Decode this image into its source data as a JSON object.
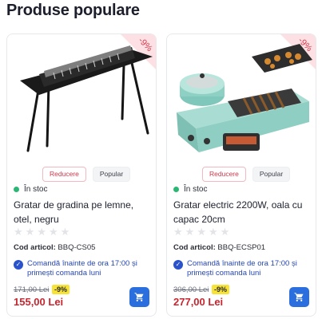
{
  "section": {
    "title": "Produse populare"
  },
  "products": [
    {
      "discount_ribbon": "-9%",
      "badges": [
        "Reducere",
        "Popular"
      ],
      "stock": "În stoc",
      "name": "Gratar de gradina pe lemne, otel, negru",
      "rating": 0,
      "code_label": "Cod articol:",
      "code": "BBQ-CS05",
      "shipping": "Comandă înainte de ora 17:00 și primești comanda luni",
      "old_price": "171,00 Lei",
      "discount": "-9%",
      "price": "155,00 Lei",
      "image_icon": "charcoal-grill-image",
      "cart_icon": "cart-icon"
    },
    {
      "discount_ribbon": "-9%",
      "badges": [
        "Reducere",
        "Popular"
      ],
      "stock": "În stoc",
      "name": "Gratar electric 2200W, oala cu capac 20cm",
      "rating": 0,
      "code_label": "Cod articol:",
      "code": "BBQ-ECSP01",
      "shipping": "Comandă înainte de ora 17:00 și primești comanda luni",
      "old_price": "306,00 Lei",
      "discount": "-9%",
      "price": "277,00 Lei",
      "image_icon": "electric-grill-image",
      "cart_icon": "cart-icon"
    }
  ],
  "colors": {
    "accent": "#2b6fde",
    "price": "#c7262f",
    "in_stock": "#2bb673",
    "discount_tag": "#f7e238"
  }
}
